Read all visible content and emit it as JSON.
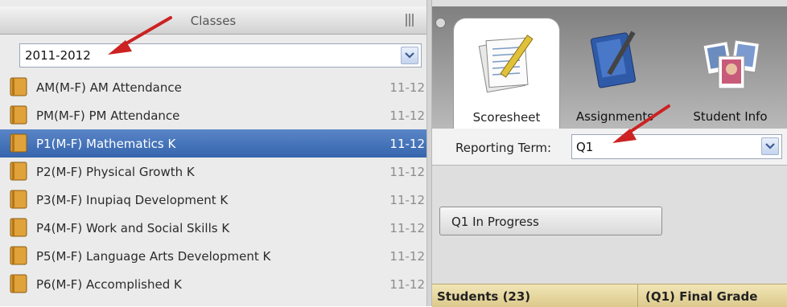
{
  "classes_panel": {
    "title": "Classes",
    "year_select": {
      "value": "2011-2012"
    },
    "items": [
      {
        "label": "AM(M-F) AM Attendance",
        "year": "11-12",
        "selected": false
      },
      {
        "label": "PM(M-F) PM Attendance",
        "year": "11-12",
        "selected": false
      },
      {
        "label": "P1(M-F) Mathematics K",
        "year": "11-12",
        "selected": true
      },
      {
        "label": "P2(M-F) Physical Growth K",
        "year": "11-12",
        "selected": false
      },
      {
        "label": "P3(M-F) Inupiaq Development K",
        "year": "11-12",
        "selected": false
      },
      {
        "label": "P4(M-F) Work and Social Skills K",
        "year": "11-12",
        "selected": false
      },
      {
        "label": "P5(M-F) Language Arts Development K",
        "year": "11-12",
        "selected": false
      },
      {
        "label": "P6(M-F) Accomplished K",
        "year": "11-12",
        "selected": false
      }
    ]
  },
  "tabs": [
    {
      "label": "Scoresheet",
      "icon": "scoresheet-icon",
      "active": true
    },
    {
      "label": "Assignments",
      "icon": "notebook-icon",
      "active": false
    },
    {
      "label": "Student Info",
      "icon": "student-photos-icon",
      "active": false
    }
  ],
  "reporting_term": {
    "label": "Reporting Term:",
    "value": "Q1"
  },
  "progress_button": {
    "label": "Q1 In Progress"
  },
  "footer": {
    "students": "Students (23)",
    "final_grade": "(Q1) Final Grade"
  },
  "colors": {
    "selection": "#3d6db5",
    "footer": "#e6d69c",
    "arrow": "#cc2222"
  }
}
